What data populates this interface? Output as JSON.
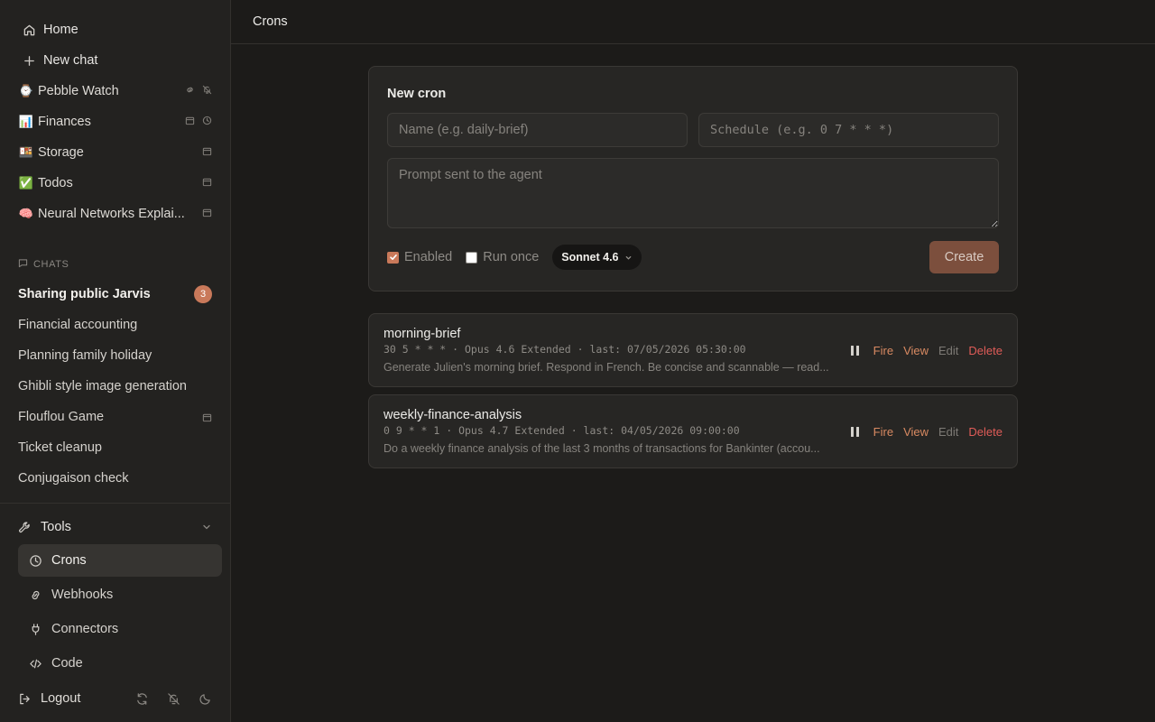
{
  "sidebar": {
    "home_label": "Home",
    "new_chat_label": "New chat",
    "projects": [
      {
        "emoji": "⌚",
        "name": "Pebble Watch",
        "icons": [
          "link-icon",
          "bell-off-icon"
        ]
      },
      {
        "emoji": "📊",
        "name": "Finances",
        "icons": [
          "calendar-icon",
          "clock-icon"
        ]
      },
      {
        "emoji": "🍱",
        "name": "Storage",
        "icons": [
          "calendar-icon"
        ]
      },
      {
        "emoji": "✅",
        "name": "Todos",
        "icons": [
          "calendar-icon"
        ]
      },
      {
        "emoji": "🧠",
        "name": "Neural Networks Explai...",
        "icons": [
          "calendar-icon"
        ]
      }
    ],
    "chats_heading": "CHATS",
    "chats": [
      {
        "name": "Sharing public Jarvis",
        "badge": "3",
        "active": true
      },
      {
        "name": "Financial accounting"
      },
      {
        "name": "Planning family holiday"
      },
      {
        "name": "Ghibli style image generation"
      },
      {
        "name": "Flouflou Game",
        "icon": "calendar-icon"
      },
      {
        "name": "Ticket cleanup"
      },
      {
        "name": "Conjugaison check"
      }
    ],
    "tools_label": "Tools",
    "tools": [
      {
        "label": "Crons",
        "icon": "clock-icon",
        "active": true
      },
      {
        "label": "Webhooks",
        "icon": "link-icon"
      },
      {
        "label": "Connectors",
        "icon": "plug-icon"
      },
      {
        "label": "Code",
        "icon": "code-icon"
      }
    ],
    "logout_label": "Logout"
  },
  "header": {
    "title": "Crons"
  },
  "new_cron": {
    "title": "New cron",
    "name_placeholder": "Name (e.g. daily-brief)",
    "schedule_placeholder": "Schedule (e.g. 0 7 * * *)",
    "prompt_placeholder": "Prompt sent to the agent",
    "enabled_label": "Enabled",
    "enabled_checked": true,
    "run_once_label": "Run once",
    "run_once_checked": false,
    "model_label": "Sonnet 4.6",
    "create_label": "Create"
  },
  "crons": [
    {
      "name": "morning-brief",
      "meta": "30 5 * * * · Opus 4.6 Extended · last: 07/05/2026 05:30:00",
      "description": "Generate Julien's morning brief. Respond in French. Be concise and scannable — read...",
      "fire": "Fire",
      "view": "View",
      "edit": "Edit",
      "delete": "Delete"
    },
    {
      "name": "weekly-finance-analysis",
      "meta": "0 9 * * 1 · Opus 4.7 Extended · last: 04/05/2026 09:00:00",
      "description": "Do a weekly finance analysis of the last 3 months of transactions for Bankinter (accou...",
      "fire": "Fire",
      "view": "View",
      "edit": "Edit",
      "delete": "Delete"
    }
  ],
  "colors": {
    "accent": "#c9795a",
    "danger": "#e05c58",
    "background": "#1c1b19",
    "sidebar": "#232220"
  }
}
